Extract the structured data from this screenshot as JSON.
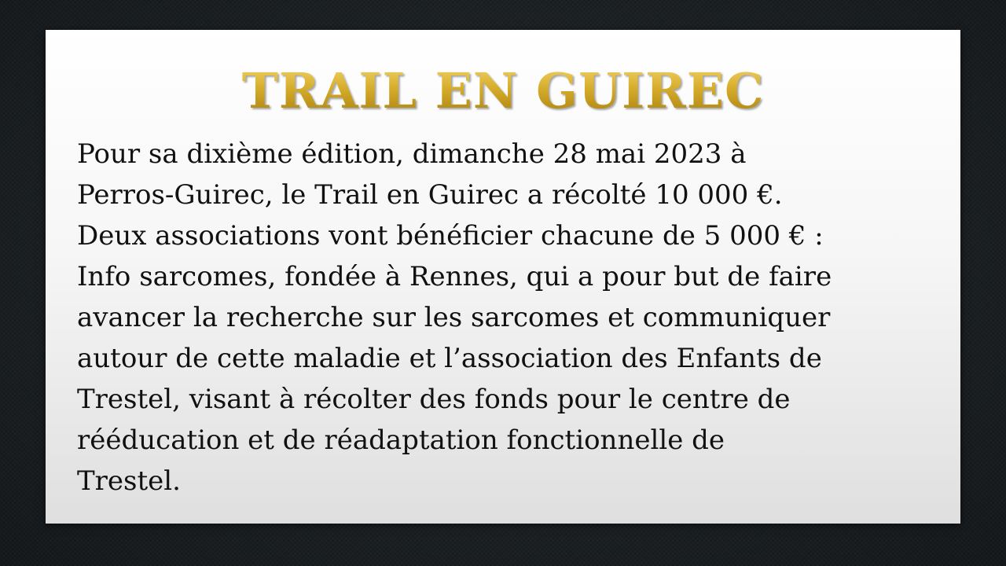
{
  "slide": {
    "title": "TRAIL EN GUIREC",
    "body_lines": [
      "Pour sa dixième édition, dimanche 28 mai 2023 à",
      "Perros-Guirec, le Trail en Guirec a récolté 10 000 €.",
      "Deux associations vont bénéficier chacune de 5 000 € :",
      "Info sarcomes, fondée à Rennes, qui a pour but de faire",
      "avancer la recherche sur les sarcomes et communiquer",
      "autour de cette maladie et l’association des Enfants de",
      "Trestel, visant à récolter des fonds pour le centre de",
      "rééducation et de réadaptation fonctionnelle de",
      "Trestel."
    ],
    "colors": {
      "title_gold": "#c99d1a",
      "body_text": "#111111",
      "card_background": "#f6f6f6",
      "frame_background": "#1b1f22"
    }
  }
}
